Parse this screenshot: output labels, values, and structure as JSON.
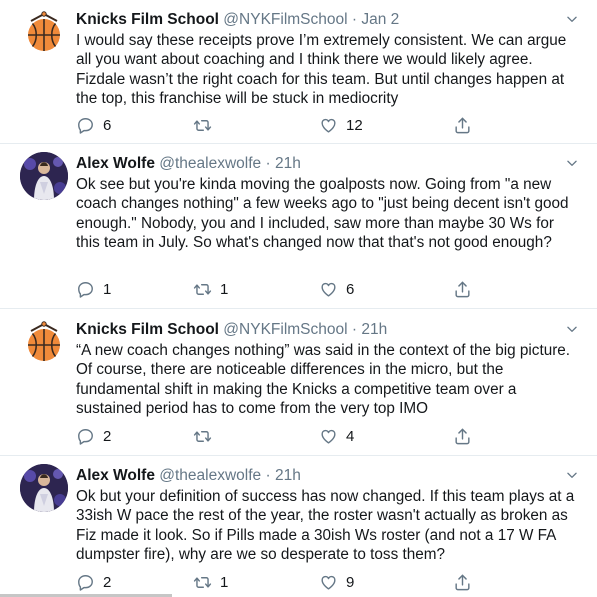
{
  "tweets": [
    {
      "author": "Knicks Film School",
      "handle": "@NYKFilmSchool",
      "separator": "·",
      "time": "Jan 2",
      "text": "I would say these receipts prove I’m extremely consistent. We can argue all you want about coaching and I think there we would likely agree. Fizdale wasn’t the right coach for this team. But until changes happen at the top, this franchise will be stuck in mediocrity",
      "replies": "6",
      "retweets": "",
      "likes": "12",
      "avatar_icon": "basketball-logo-icon"
    },
    {
      "author": "Alex Wolfe",
      "handle": "@thealexwolfe",
      "separator": "·",
      "time": "21h",
      "text": "Ok see but you're kinda moving the goalposts now. Going from \"a new coach changes nothing\" a few weeks ago to \"just being decent isn't good enough.\" Nobody, you and I included, saw more than maybe 30 Ws for this team in July. So what's changed now that that's not good enough?",
      "replies": "1",
      "retweets": "1",
      "likes": "6",
      "avatar_icon": "person-photo-icon"
    },
    {
      "author": "Knicks Film School",
      "handle": "@NYKFilmSchool",
      "separator": "·",
      "time": "21h",
      "text": "“A new coach changes nothing” was said in the context of the big picture. Of course, there are noticeable differences in the micro, but the fundamental shift in making the Knicks a competitive team over a sustained period has to come from the very top IMO",
      "replies": "2",
      "retweets": "",
      "likes": "4",
      "avatar_icon": "basketball-logo-icon"
    },
    {
      "author": "Alex Wolfe",
      "handle": "@thealexwolfe",
      "separator": "·",
      "time": "21h",
      "text": "Ok but your definition of success has now changed. If this team plays at a 33ish W pace the rest of the year, the roster wasn't actually as broken as Fiz made it look. So if Pills made a 30ish Ws roster (and not a 17 W FA dumpster fire), why are we so desperate to toss them?",
      "replies": "2",
      "retweets": "1",
      "likes": "9",
      "avatar_icon": "person-photo-icon"
    }
  ],
  "colors": {
    "text": "#14171a",
    "secondary": "#657786",
    "divider": "#e6ecf0",
    "orange": "#f08a3a"
  }
}
